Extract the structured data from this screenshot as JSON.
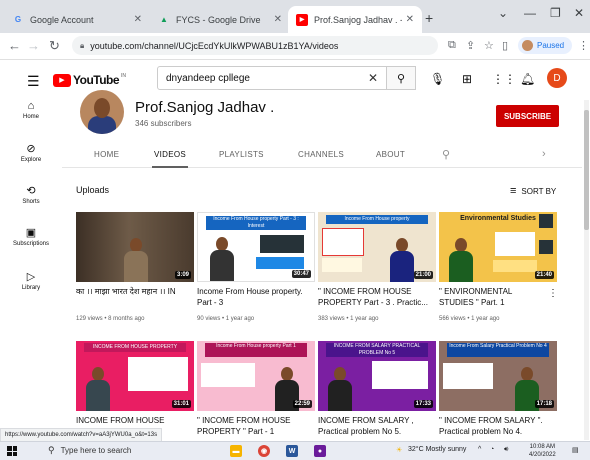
{
  "browser": {
    "tabs": [
      {
        "title": "Google Account",
        "fav": "G",
        "fav_color": "#4285f4"
      },
      {
        "title": "FYCS - Google Drive",
        "fav": "▲",
        "fav_color": "#0f9d58"
      },
      {
        "title": "Prof.Sanjog Jadhav . - YouTube",
        "fav": "▶",
        "fav_color": "#ff0000"
      }
    ],
    "url": "youtube.com/channel/UCjcEcdYkUlkWPWABU1zB1YA/videos",
    "profile_label": "Paused"
  },
  "youtube": {
    "logo_text": "YouTube",
    "logo_country": "IN",
    "search_value": "dnyandeep cpllege",
    "avatar_letter": "D"
  },
  "rail": [
    {
      "label": "Home",
      "icon": "home-icon",
      "glyph": "⌂"
    },
    {
      "label": "Explore",
      "icon": "compass-icon",
      "glyph": "◎"
    },
    {
      "label": "Shorts",
      "icon": "shorts-icon",
      "glyph": "⟳"
    },
    {
      "label": "Subscriptions",
      "icon": "subscriptions-icon",
      "glyph": "▣"
    },
    {
      "label": "Library",
      "icon": "library-icon",
      "glyph": "▶"
    }
  ],
  "channel": {
    "name": "Prof.Sanjog Jadhav .",
    "subscribers": "346 subscribers",
    "subscribe_label": "SUBSCRIBE",
    "tabs": [
      "HOME",
      "VIDEOS",
      "PLAYLISTS",
      "CHANNELS",
      "ABOUT"
    ],
    "active_tab": "VIDEOS"
  },
  "section": {
    "title": "Uploads",
    "sort_label": "SORT BY"
  },
  "videos": [
    {
      "title": "का ।। माझा भारत देश महान ।। IN",
      "meta": "129 views • 8 months ago",
      "duration": "3:09",
      "bg": "#5a4a3a",
      "banner": "",
      "banner_color": "",
      "shirt": "#8a6a4a"
    },
    {
      "title": "Income From House property. Part - 3",
      "meta": "90 views • 1 year ago",
      "duration": "30:47",
      "bg": "#ffffff",
      "banner": "Income From House property Part - 3 : Interest",
      "banner_color": "#1565c0",
      "shirt": "#333333"
    },
    {
      "title": "\" INCOME FROM HOUSE PROPERTY Part - 3 . Practic...",
      "meta": "383 views • 1 year ago",
      "duration": "21:00",
      "bg": "#f2e9d8",
      "banner": "Income From House property",
      "banner_color": "#1565c0",
      "shirt": "#1a237e"
    },
    {
      "title": "\" ENVIRONMENTAL STUDIES \" Part. 1",
      "meta": "566 views • 1 year ago",
      "duration": "21:40",
      "bg": "#f3c34a",
      "banner": "Environmental Studies",
      "banner_color": "#f3c34a",
      "shirt": "#1b5e20"
    },
    {
      "title": "INCOME FROM HOUSE PROPERTY",
      "meta": "",
      "duration": "31:01",
      "bg": "#e91e63",
      "banner": "INCOME FROM HOUSE PROPERTY",
      "banner_color": "#c2185b",
      "shirt": "#37474f"
    },
    {
      "title": "\" INCOME FROM HOUSE PROPERTY \" Part - 1",
      "meta": "",
      "duration": "22:59",
      "bg": "#f8bbd0",
      "banner": "Income From House property Part 1",
      "banner_color": "#ad1457",
      "shirt": "#212121"
    },
    {
      "title": "INCOME FROM SALARY , Practical problem No 5.",
      "meta": "",
      "duration": "17:33",
      "bg": "#7b1fa2",
      "banner": "INCOME FROM SALARY PRACTICAL PROBLEM No 5",
      "banner_color": "#4a148c",
      "shirt": "#212121"
    },
    {
      "title": "\" INCOME FROM SALARY \". Practical problem No 4.",
      "meta": "",
      "duration": "17:18",
      "bg": "#8d6e63",
      "banner": "Income From Salary Practical Problem No 4",
      "banner_color": "#0d47a1",
      "shirt": "#1b5e20"
    }
  ],
  "status_url": "https://www.youtube.com/watch?v=aA3jYWU0a_o&t=13s",
  "taskbar": {
    "search_placeholder": "Type here to search",
    "weather": "32°C  Mostly sunny",
    "time": "10:08 AM",
    "date": "4/20/2022"
  }
}
